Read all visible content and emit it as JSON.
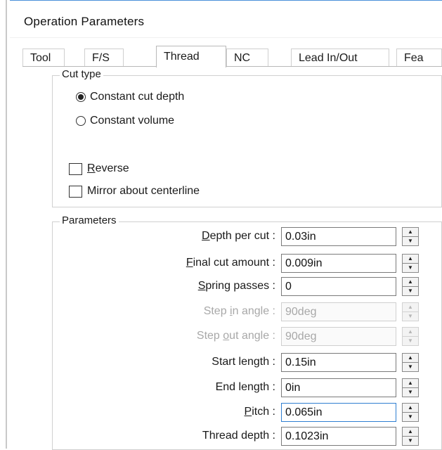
{
  "window": {
    "title": "Operation Parameters"
  },
  "tabs": [
    {
      "label": "Tool",
      "active": false
    },
    {
      "label": "F/S",
      "active": false
    },
    {
      "label": "Thread",
      "active": true
    },
    {
      "label": "NC",
      "active": false
    },
    {
      "label": "Lead In/Out",
      "active": false
    },
    {
      "label": "Fea",
      "active": false
    }
  ],
  "cut_type": {
    "group_label": "Cut type",
    "options": [
      {
        "label": "Constant cut depth",
        "selected": true
      },
      {
        "label": "Constant volume",
        "selected": false
      }
    ]
  },
  "options": {
    "reverse": {
      "label_accel": "R",
      "label_rest": "everse",
      "checked": false
    },
    "mirror": {
      "label": "Mirror about centerline",
      "checked": false
    }
  },
  "parameters": {
    "group_label": "Parameters",
    "rows": [
      {
        "label_accel": "D",
        "label_rest": "epth per cut :",
        "value": "0.03in",
        "enabled": true
      },
      {
        "label_accel": "F",
        "label_rest": "inal cut amount :",
        "value": "0.009in",
        "enabled": true
      },
      {
        "label_accel": "S",
        "label_rest": "pring passes :",
        "value": "0",
        "enabled": true
      },
      {
        "label_pre": "Step ",
        "label_accel": "i",
        "label_rest": "n angle :",
        "value": "90deg",
        "enabled": false
      },
      {
        "label_pre": "Step ",
        "label_accel": "o",
        "label_rest": "ut angle :",
        "value": "90deg",
        "enabled": false
      },
      {
        "label_pre": "Start length :",
        "value": "0.15in",
        "enabled": true
      },
      {
        "label_pre": "End length :",
        "value": "0in",
        "enabled": true
      },
      {
        "label_accel": "P",
        "label_rest": "itch :",
        "value": "0.065in",
        "enabled": true,
        "focused": true
      },
      {
        "label_pre": "Thread depth :",
        "value": "0.1023in",
        "enabled": true
      }
    ]
  },
  "icons": {
    "spin_up": "▲",
    "spin_down": "▼"
  },
  "colors": {
    "focus_border": "#2f7fd1",
    "disabled_text": "#a8a8a8",
    "title_border": "#4a90d9"
  }
}
